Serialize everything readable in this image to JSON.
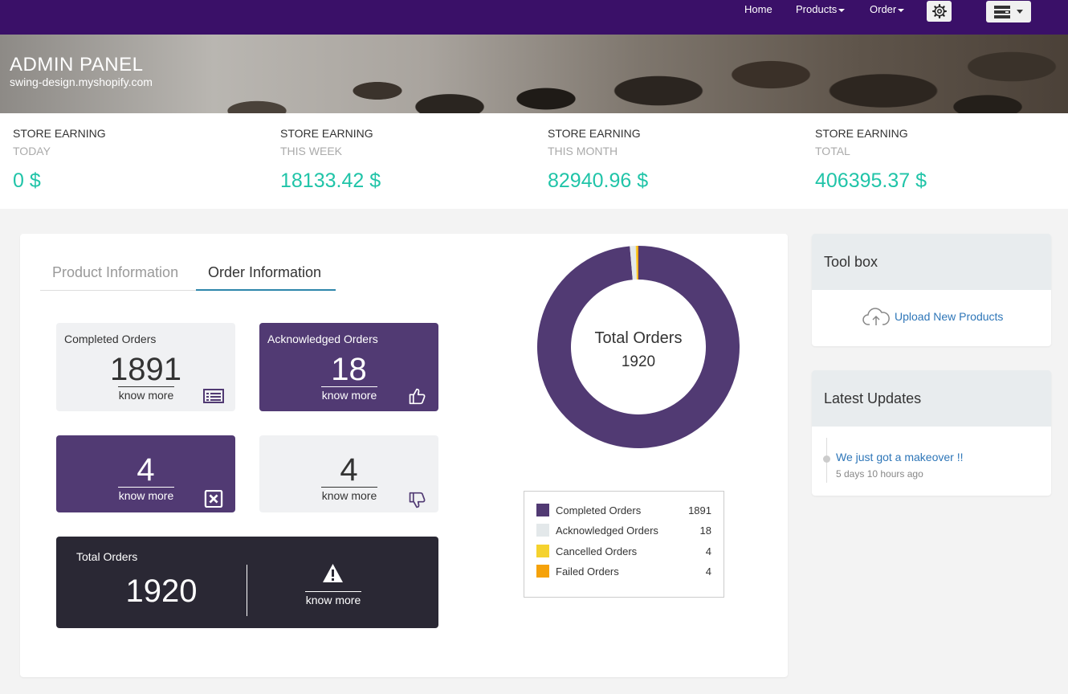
{
  "nav": {
    "home": "Home",
    "products": "Products",
    "order": "Order"
  },
  "hero": {
    "title": "ADMIN PANEL",
    "subtitle": "swing-design.myshopify.com"
  },
  "earnings": [
    {
      "label": "STORE EARNING",
      "period": "TODAY",
      "value": "0 $"
    },
    {
      "label": "STORE EARNING",
      "period": "THIS WEEK",
      "value": "18133.42 $"
    },
    {
      "label": "STORE EARNING",
      "period": "THIS MONTH",
      "value": "82940.96 $"
    },
    {
      "label": "STORE EARNING",
      "period": "TOTAL",
      "value": "406395.37 $"
    }
  ],
  "tabs": {
    "product": "Product Information",
    "order": "Order Information"
  },
  "tiles": {
    "completed": {
      "title": "Completed Orders",
      "count": "1891",
      "link": "know more"
    },
    "acknowledged": {
      "title": "Acknowledged Orders",
      "count": "18",
      "link": "know more"
    },
    "cancelled": {
      "count": "4",
      "link": "know more"
    },
    "failed": {
      "count": "4",
      "link": "know more"
    },
    "total": {
      "title": "Total Orders",
      "count": "1920",
      "link": "know more"
    }
  },
  "donut": {
    "title": "Total Orders",
    "total": "1920"
  },
  "chart_data": {
    "type": "pie",
    "categories": [
      "Completed Orders",
      "Acknowledged Orders",
      "Cancelled Orders",
      "Failed Orders"
    ],
    "values": [
      1891,
      18,
      4,
      4
    ],
    "colors": [
      "#513a73",
      "#e3e8ea",
      "#f5d22e",
      "#f5a20a"
    ],
    "title": "Total Orders",
    "legend": "bottom"
  },
  "toolbox": {
    "title": "Tool box",
    "upload": "Upload New Products"
  },
  "updates": {
    "title": "Latest Updates",
    "item": "We just got a makeover !!",
    "time": "5 days 10 hours ago"
  }
}
